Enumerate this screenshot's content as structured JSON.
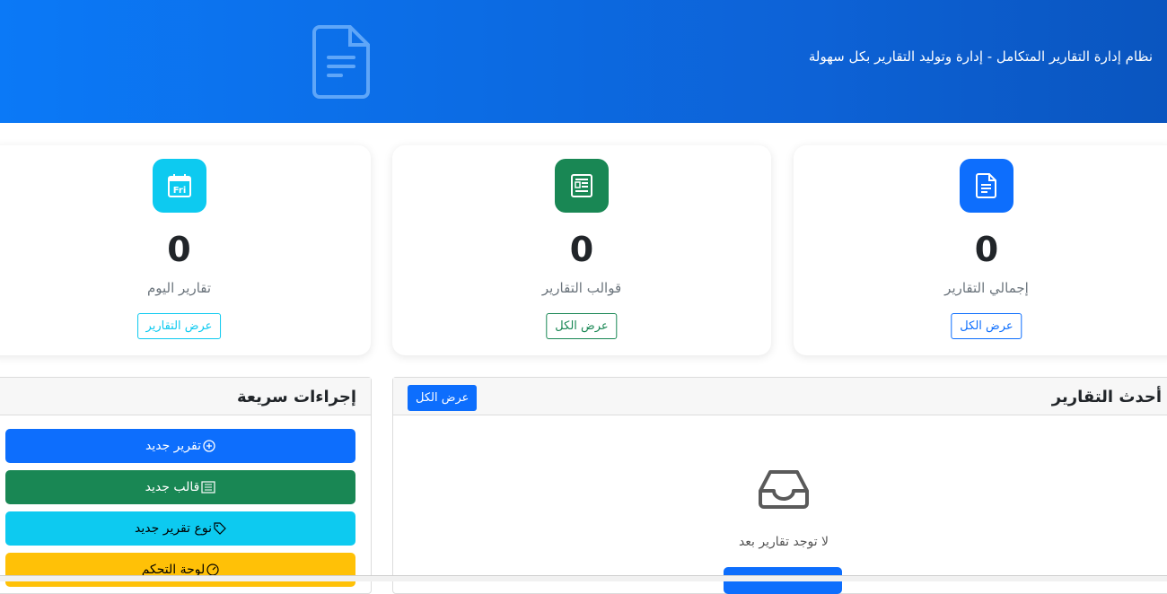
{
  "header": {
    "subtitle": "نظام إدارة التقارير المتكامل - إدارة وتوليد التقارير بكل سهولة"
  },
  "stats": [
    {
      "value": "0",
      "label": "إجمالي التقارير",
      "button": "عرض الكل",
      "color": "#0d6efd",
      "icon": "file-text-icon"
    },
    {
      "value": "0",
      "label": "قوالب التقارير",
      "button": "عرض الكل",
      "color": "#198754",
      "icon": "newspaper-icon"
    },
    {
      "value": "0",
      "label": "تقارير اليوم",
      "button": "عرض التقارير",
      "color": "#0dcaf0",
      "icon": "calendar-icon",
      "icon_text": "Fri"
    }
  ],
  "recent": {
    "title": "أحدث التقارير",
    "view_all": "عرض الكل",
    "empty_text": "لا توجد تقارير بعد",
    "empty_icon": "inbox-icon"
  },
  "quick_actions": {
    "title": "إجراءات سريعة",
    "items": [
      {
        "label": "تقرير جديد",
        "icon": "plus-circle-icon",
        "color": "#0d6efd"
      },
      {
        "label": "قالب جديد",
        "icon": "file-list-icon",
        "color": "#198754"
      },
      {
        "label": "نوع تقرير جديد",
        "icon": "tags-icon",
        "color": "#0dcaf0"
      },
      {
        "label": "لوحة التحكم",
        "icon": "speedometer-icon",
        "color": "#ffc107"
      }
    ]
  }
}
